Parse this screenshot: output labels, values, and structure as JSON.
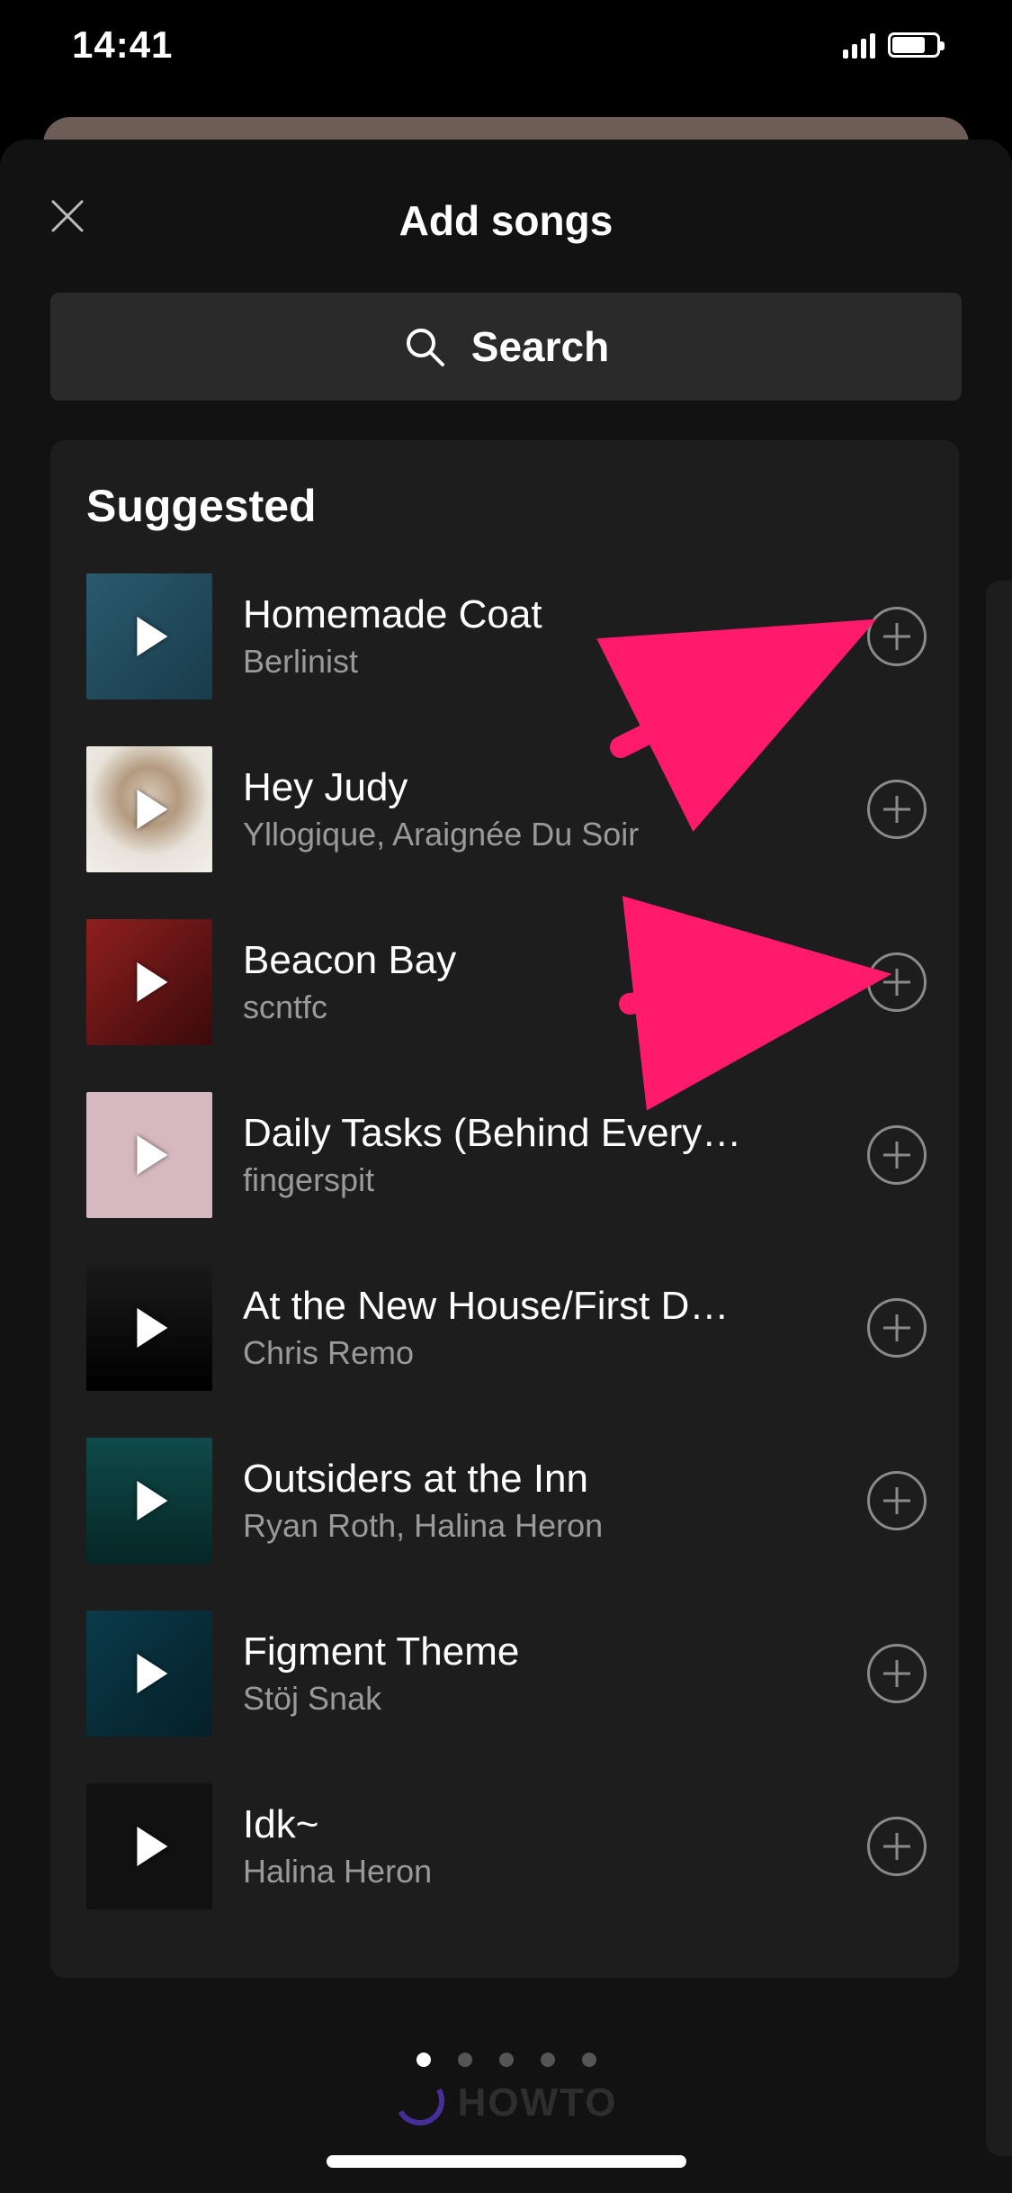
{
  "status": {
    "time": "14:41"
  },
  "header": {
    "title": "Add songs"
  },
  "search": {
    "label": "Search"
  },
  "section": {
    "title": "Suggested"
  },
  "tracks": [
    {
      "title": "Homemade Coat",
      "artist": "Berlinist"
    },
    {
      "title": "Hey Judy",
      "artist": "Yllogique, Araignée Du Soir"
    },
    {
      "title": "Beacon Bay",
      "artist": "scntfc"
    },
    {
      "title": "Daily Tasks (Behind Every…",
      "artist": "fingerspit"
    },
    {
      "title": "At the New House/First D…",
      "artist": "Chris Remo"
    },
    {
      "title": "Outsiders at the Inn",
      "artist": "Ryan Roth, Halina Heron"
    },
    {
      "title": "Figment Theme",
      "artist": "Stöj Snak"
    },
    {
      "title": "Idk~",
      "artist": "Halina Heron"
    }
  ],
  "pager": {
    "count": 5,
    "active": 0
  },
  "watermark": {
    "text": "HOWTO"
  }
}
